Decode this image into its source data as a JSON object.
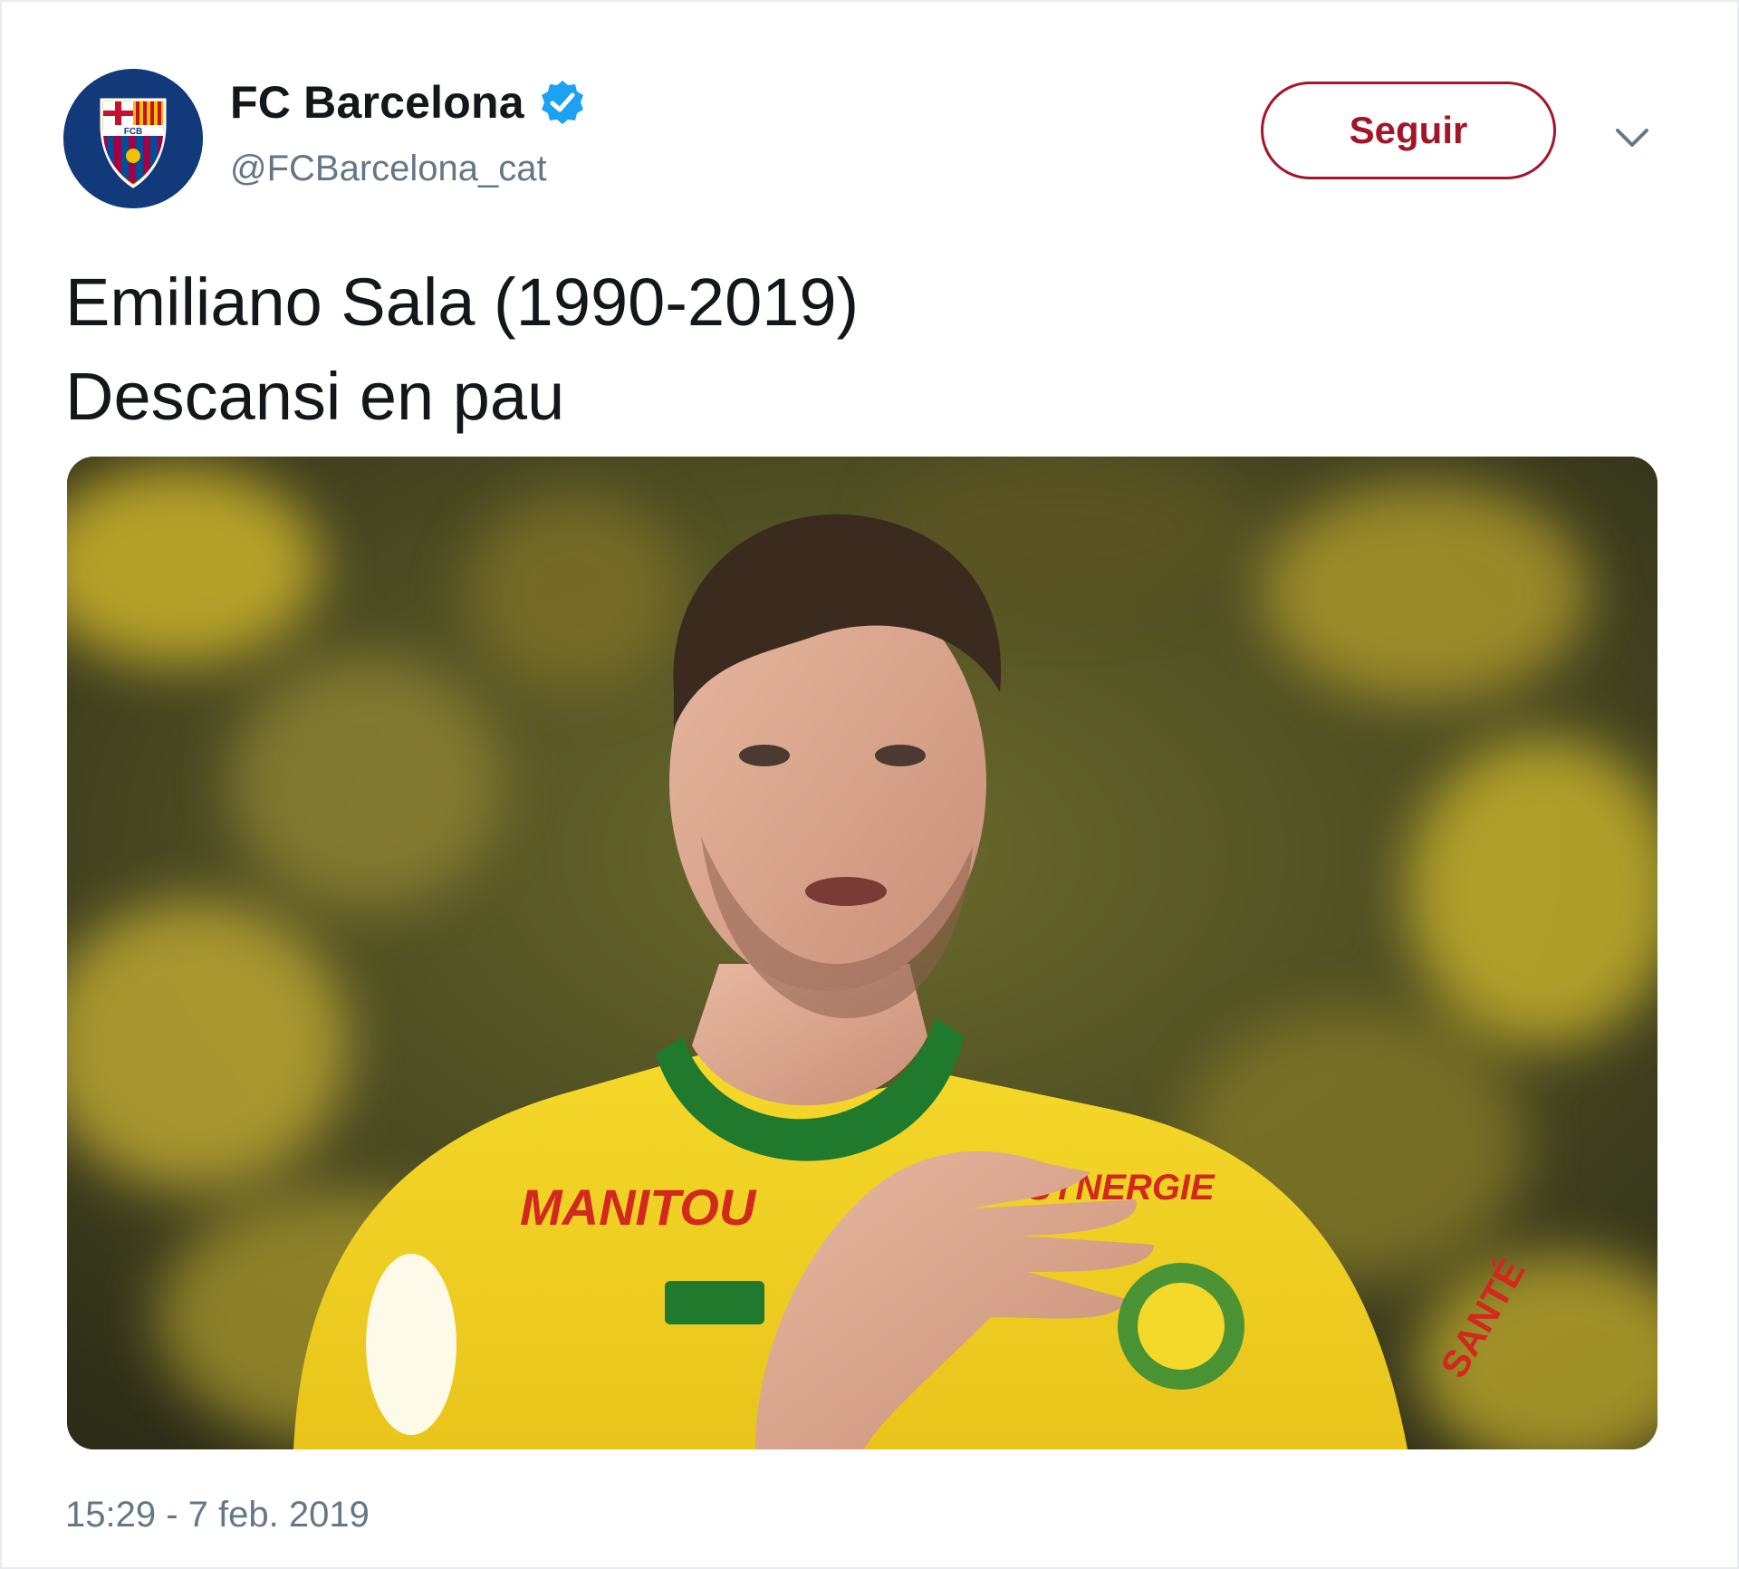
{
  "account": {
    "display_name": "FC Barcelona",
    "handle": "@FCBarcelona_cat",
    "verified": true,
    "avatar_icon": "fc-barcelona-crest-icon"
  },
  "actions": {
    "follow_label": "Seguir",
    "more_icon": "chevron-down-icon"
  },
  "tweet": {
    "text_line_1": "Emiliano Sala (1990-2019)",
    "text_line_2": "Descansi en pau",
    "timestamp": "15:29 - 7 feb. 2019"
  },
  "media": {
    "jersey_sponsor": "MANITOU",
    "jersey_sponsor_2": "SYNERGIE",
    "sleeve_text": "SANTÉ"
  },
  "colors": {
    "follow_accent": "#a3162a",
    "verified_blue": "#1da1f2",
    "muted_text": "#657786",
    "jersey_yellow": "#f2d020",
    "jersey_green": "#1f7a2e"
  }
}
